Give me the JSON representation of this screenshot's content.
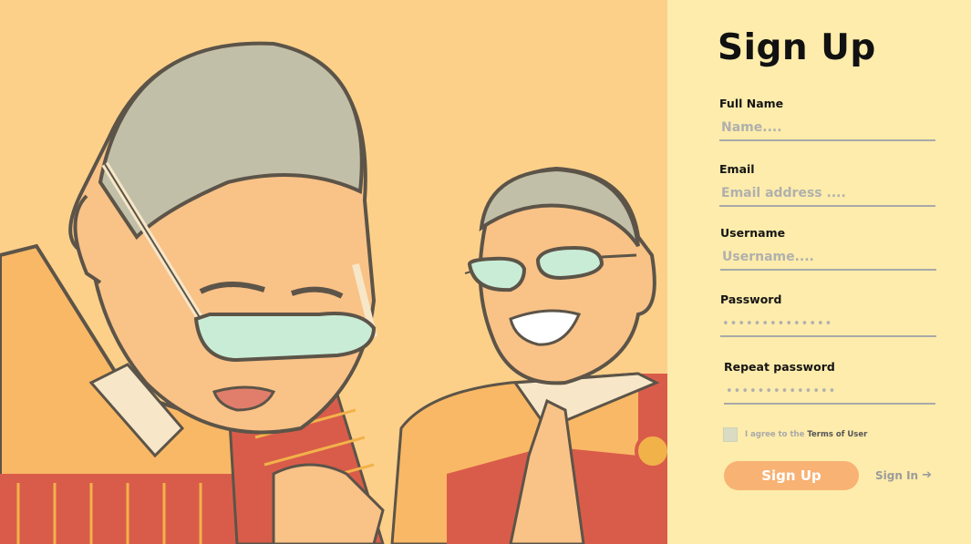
{
  "form": {
    "title": "Sign Up",
    "full_name": {
      "label": "Full Name",
      "placeholder": "Name....",
      "value": ""
    },
    "email": {
      "label": "Email",
      "placeholder": "Email address ....",
      "value": ""
    },
    "username": {
      "label": "Username",
      "placeholder": "Username....",
      "value": ""
    },
    "password": {
      "label": "Password",
      "value": "••••••••••••••"
    },
    "repeat_password": {
      "label": "Repeat password",
      "value": "••••••••••••••"
    },
    "agree": {
      "prefix": "I agree to the",
      "terms": "Terms of User",
      "checked": false
    },
    "signup_label": "Sign Up",
    "signin_label": "Sign In",
    "signin_icon": "arrow-right-icon"
  },
  "colors": {
    "panel_bg": "#fdecab",
    "illustration_bg": "#fdd08a",
    "button": "#f8b274"
  }
}
